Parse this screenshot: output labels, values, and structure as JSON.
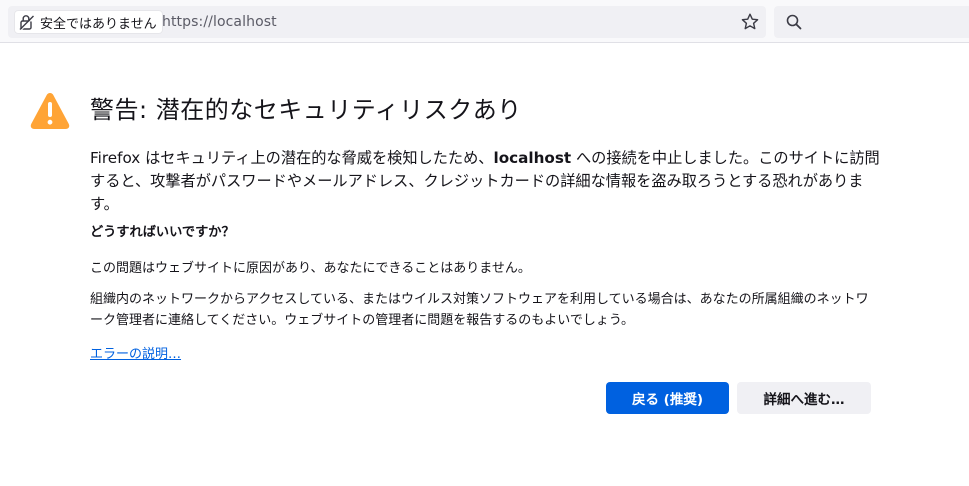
{
  "browser": {
    "identity_label": "安全ではありません",
    "url": "https://localhost",
    "icons": {
      "identity": "insecure-lock-icon",
      "bookmark": "star-icon",
      "search": "search-icon"
    }
  },
  "error_page": {
    "icon": "warning-icon",
    "title": "警告: 潜在的なセキュリティリスクあり",
    "intro_before_host": "Firefox はセキュリティ上の潜在的な脅威を検知したため、",
    "host": "localhost",
    "intro_after_host": " への接続を中止しました。このサイトに訪問すると、攻撃者がパスワードやメールアドレス、クレジットカードの詳細な情報を盗み取ろうとする恐れがあります。",
    "question": "どうすればいいですか？",
    "answer_1": "この問題はウェブサイトに原因があり、あなたにできることはありません。",
    "answer_2": "組織内のネットワークからアクセスしている、またはウイルス対策ソフトウェアを利用している場合は、あなたの所属組織のネットワーク管理者に連絡してください。ウェブサイトの管理者に問題を報告するのもよいでしょう。",
    "learn_more": "エラーの説明…",
    "buttons": {
      "back": "戻る (推奨)",
      "advanced": "詳細へ進む…"
    }
  },
  "colors": {
    "accent": "#0061e0",
    "warning": "#ffa436",
    "text": "#15141a",
    "secondary_button_bg": "#f0f0f4"
  }
}
